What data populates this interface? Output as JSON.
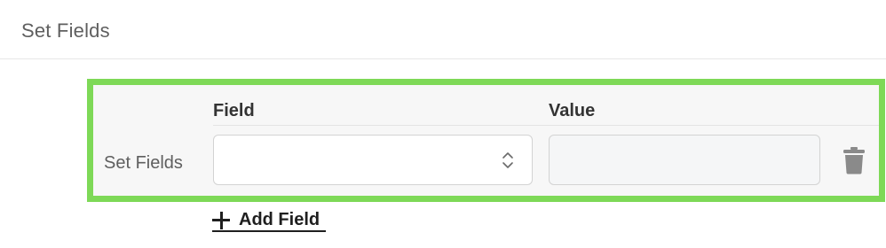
{
  "section": {
    "title": "Set Fields"
  },
  "table": {
    "columns": {
      "field": "Field",
      "value": "Value"
    },
    "rows": [
      {
        "label": "Set Fields",
        "field_value": "",
        "value": ""
      }
    ]
  },
  "actions": {
    "add_field_label": "Add Field"
  },
  "colors": {
    "highlight_border": "#7ed957",
    "row_background": "#f7f7f7",
    "text_muted": "#5f5f5f",
    "text_strong": "#333333",
    "icon_gray": "#8a8a8a"
  },
  "icons": {
    "select_arrows": "chevron-up-down-icon",
    "delete": "trash-icon",
    "add": "plus-icon"
  }
}
